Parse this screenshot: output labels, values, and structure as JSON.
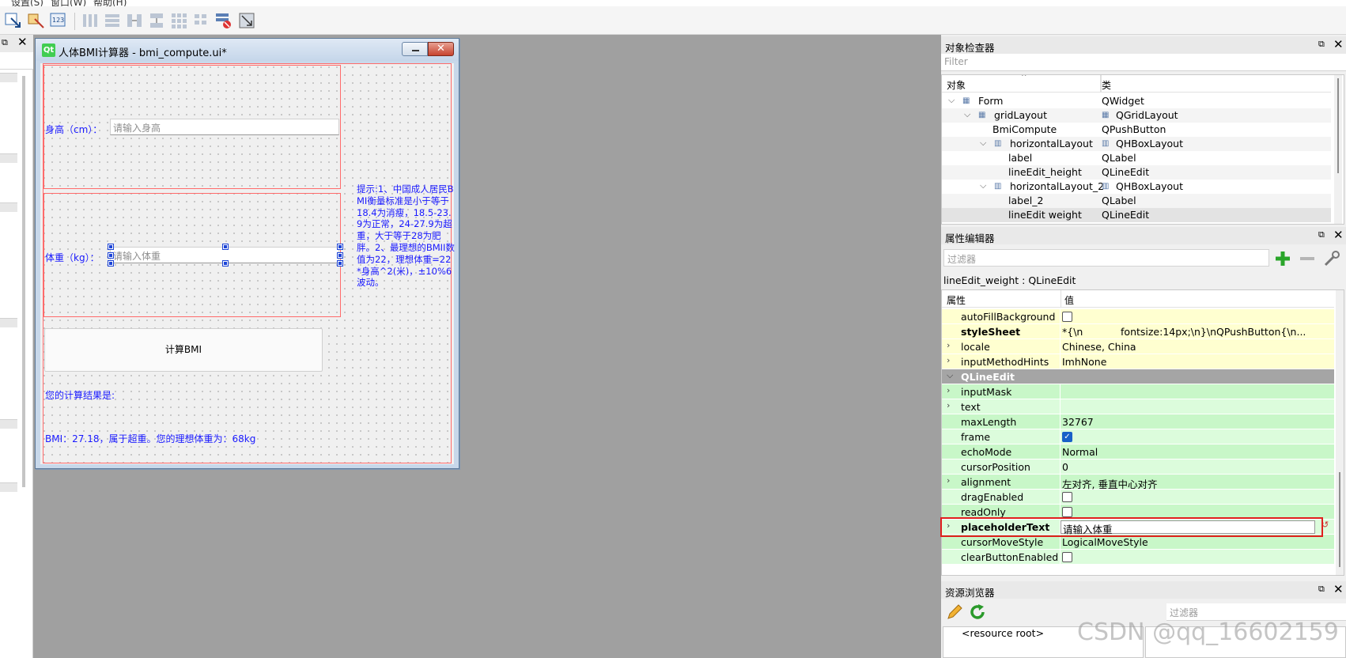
{
  "menu": {
    "items": [
      "设置(S)",
      "窗口(W)",
      "帮助(H)"
    ]
  },
  "form": {
    "title": "人体BMI计算器 - bmi_compute.ui*",
    "logo_text": "Qt",
    "height_label": "身高（cm）：",
    "height_placeholder": "请输入身高",
    "weight_label": "体重（kg）：",
    "weight_placeholder": "请输入体重",
    "hint": "提示:1、中国成人居民BMI衡量标准是小于等于18.4为消瘦，18.5-23.9为正常，24-27.9为超重，大于等于28为肥胖。2、最理想的BMII数值为22，理想体重=22*身高^2(米)，±10%6波动。",
    "button_label": "计算BMI",
    "result_label": "您的计算结果是:",
    "result_value": "BMI：27.18，属于超重。您的理想体重为：68kg"
  },
  "object_inspector": {
    "title": "对象检查器",
    "filter_placeholder": "Filter",
    "col_object": "对象",
    "col_class": "类",
    "rows": [
      {
        "name": "Form",
        "cls": "QWidget"
      },
      {
        "name": "gridLayout",
        "cls": "QGridLayout"
      },
      {
        "name": "BmiCompute",
        "cls": "QPushButton"
      },
      {
        "name": "horizontalLayout",
        "cls": "QHBoxLayout"
      },
      {
        "name": "label",
        "cls": "QLabel"
      },
      {
        "name": "lineEdit_height",
        "cls": "QLineEdit"
      },
      {
        "name": "horizontalLayout_2",
        "cls": "QHBoxLayout"
      },
      {
        "name": "label_2",
        "cls": "QLabel"
      },
      {
        "name": "lineEdit weight",
        "cls": "QLineEdit"
      }
    ]
  },
  "property_editor": {
    "title": "属性编辑器",
    "filter_placeholder": "过滤器",
    "object_label": "lineEdit_weight : QLineEdit",
    "col_property": "属性",
    "col_value": "值",
    "rows": [
      {
        "name": "autoFillBackground",
        "value": ""
      },
      {
        "name": "styleSheet",
        "value": "*{\\n            fontsize:14px;\\n}\\nQPushButton{\\n..."
      },
      {
        "name": "locale",
        "value": "Chinese, China"
      },
      {
        "name": "inputMethodHints",
        "value": "ImhNone"
      },
      {
        "name": "QLineEdit",
        "value": ""
      },
      {
        "name": "inputMask",
        "value": ""
      },
      {
        "name": "text",
        "value": ""
      },
      {
        "name": "maxLength",
        "value": "32767"
      },
      {
        "name": "frame",
        "value": ""
      },
      {
        "name": "echoMode",
        "value": "Normal"
      },
      {
        "name": "cursorPosition",
        "value": "0"
      },
      {
        "name": "alignment",
        "value": "左对齐, 垂直中心对齐"
      },
      {
        "name": "dragEnabled",
        "value": ""
      },
      {
        "name": "readOnly",
        "value": ""
      },
      {
        "name": "placeholderText",
        "value": "请输入体重"
      },
      {
        "name": "cursorMoveStyle",
        "value": "LogicalMoveStyle"
      },
      {
        "name": "clearButtonEnabled",
        "value": ""
      }
    ]
  },
  "resource_browser": {
    "title": "资源浏览器",
    "filter_placeholder": "过滤器",
    "root_label": "<resource root>"
  },
  "watermark": "CSDN @qq_16602159",
  "colors": {
    "designer_bg": "#a0a0a0",
    "layout_border": "#ff6b6b",
    "label_blue": "#1a1aff",
    "prop_yellow": "#ffffd0",
    "prop_green": "#c8f7c8",
    "prop_green_light": "#dcfcdc",
    "prop_group_gray": "#a5a5a5",
    "highlight_red": "#e0201e"
  }
}
